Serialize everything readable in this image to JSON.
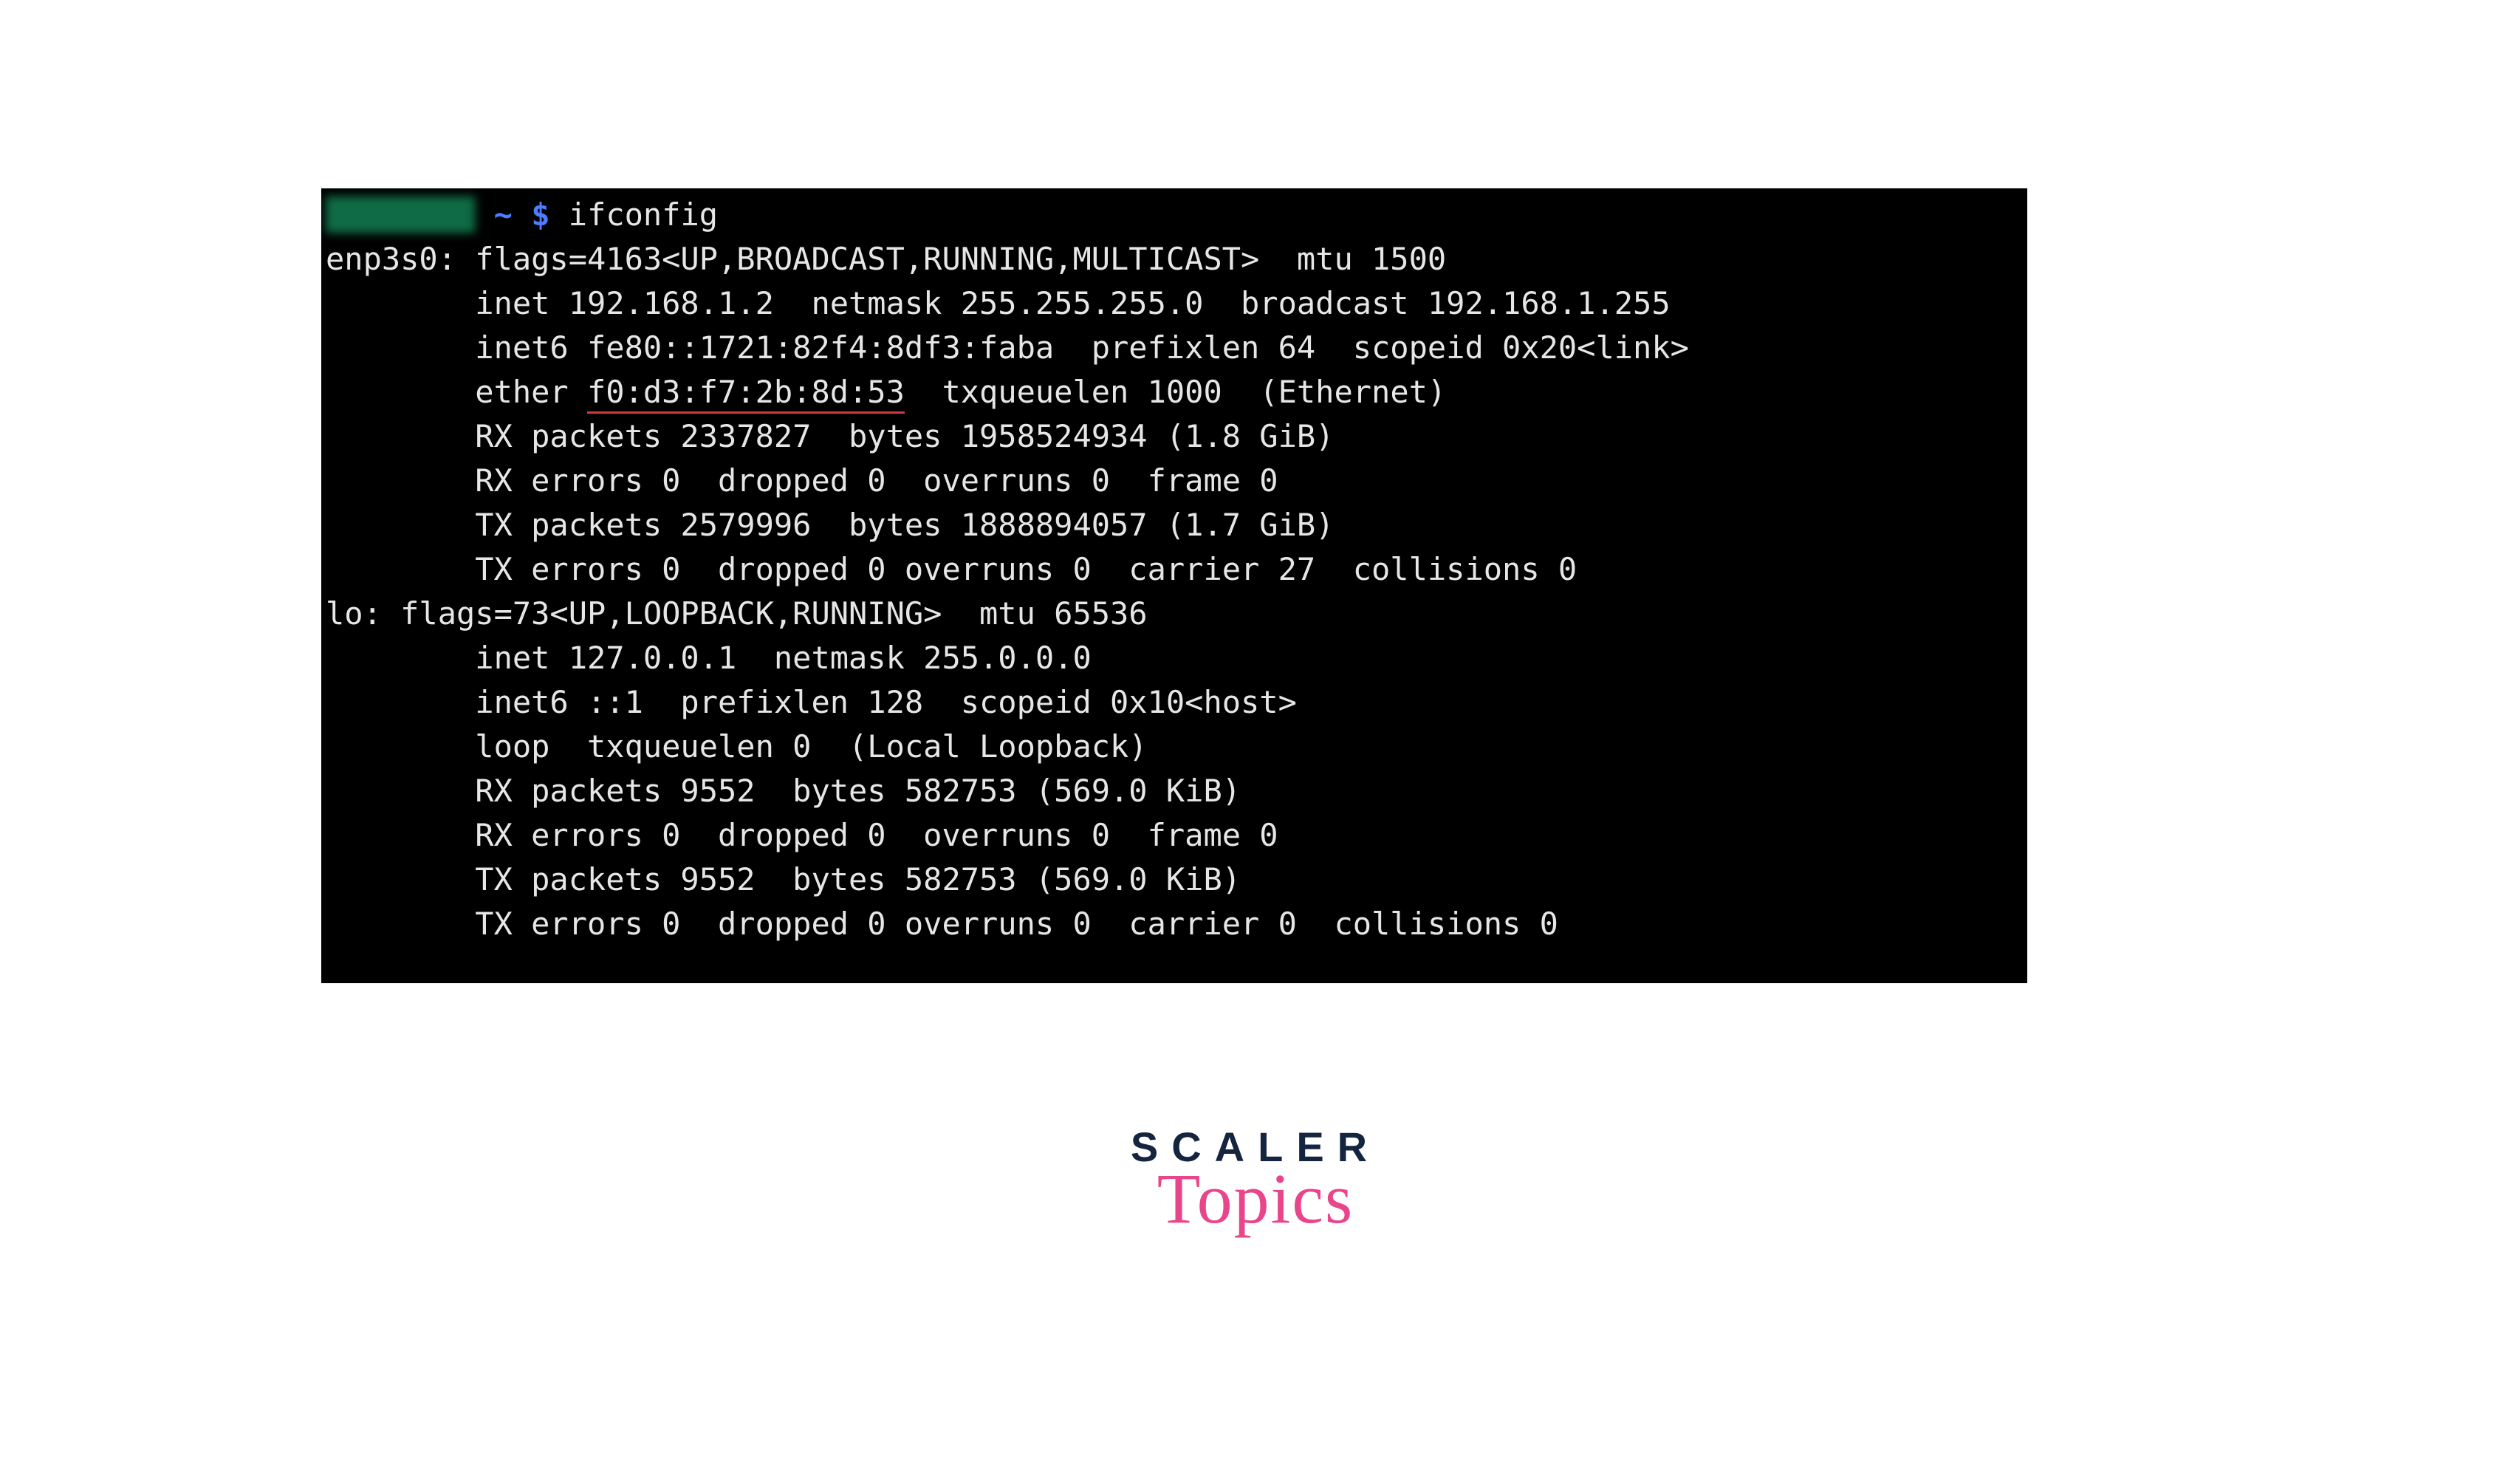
{
  "terminal": {
    "prompt_host": "████████",
    "prompt_tilde": "~",
    "prompt_dollar": "$",
    "command": "ifconfig",
    "mac_address": "f0:d3:f7:2b:8d:53",
    "line1": "enp3s0: flags=4163<UP,BROADCAST,RUNNING,MULTICAST>  mtu 1500",
    "line2": "        inet 192.168.1.2  netmask 255.255.255.0  broadcast 192.168.1.255",
    "line3": "        inet6 fe80::1721:82f4:8df3:faba  prefixlen 64  scopeid 0x20<link>",
    "line4a": "        ether ",
    "line4b": "  txqueuelen 1000  (Ethernet)",
    "line5": "        RX packets 2337827  bytes 1958524934 (1.8 GiB)",
    "line6": "        RX errors 0  dropped 0  overruns 0  frame 0",
    "line7": "        TX packets 2579996  bytes 1888894057 (1.7 GiB)",
    "line8": "        TX errors 0  dropped 0 overruns 0  carrier 27  collisions 0",
    "blank": "",
    "line9": "lo: flags=73<UP,LOOPBACK,RUNNING>  mtu 65536",
    "line10": "        inet 127.0.0.1  netmask 255.0.0.0",
    "line11": "        inet6 ::1  prefixlen 128  scopeid 0x10<host>",
    "line12": "        loop  txqueuelen 0  (Local Loopback)",
    "line13": "        RX packets 9552  bytes 582753 (569.0 KiB)",
    "line14": "        RX errors 0  dropped 0  overruns 0  frame 0",
    "line15": "        TX packets 9552  bytes 582753 (569.0 KiB)",
    "line16": "        TX errors 0  dropped 0 overruns 0  carrier 0  collisions 0"
  },
  "branding": {
    "scaler": "SCALER",
    "topics": "Topics"
  }
}
